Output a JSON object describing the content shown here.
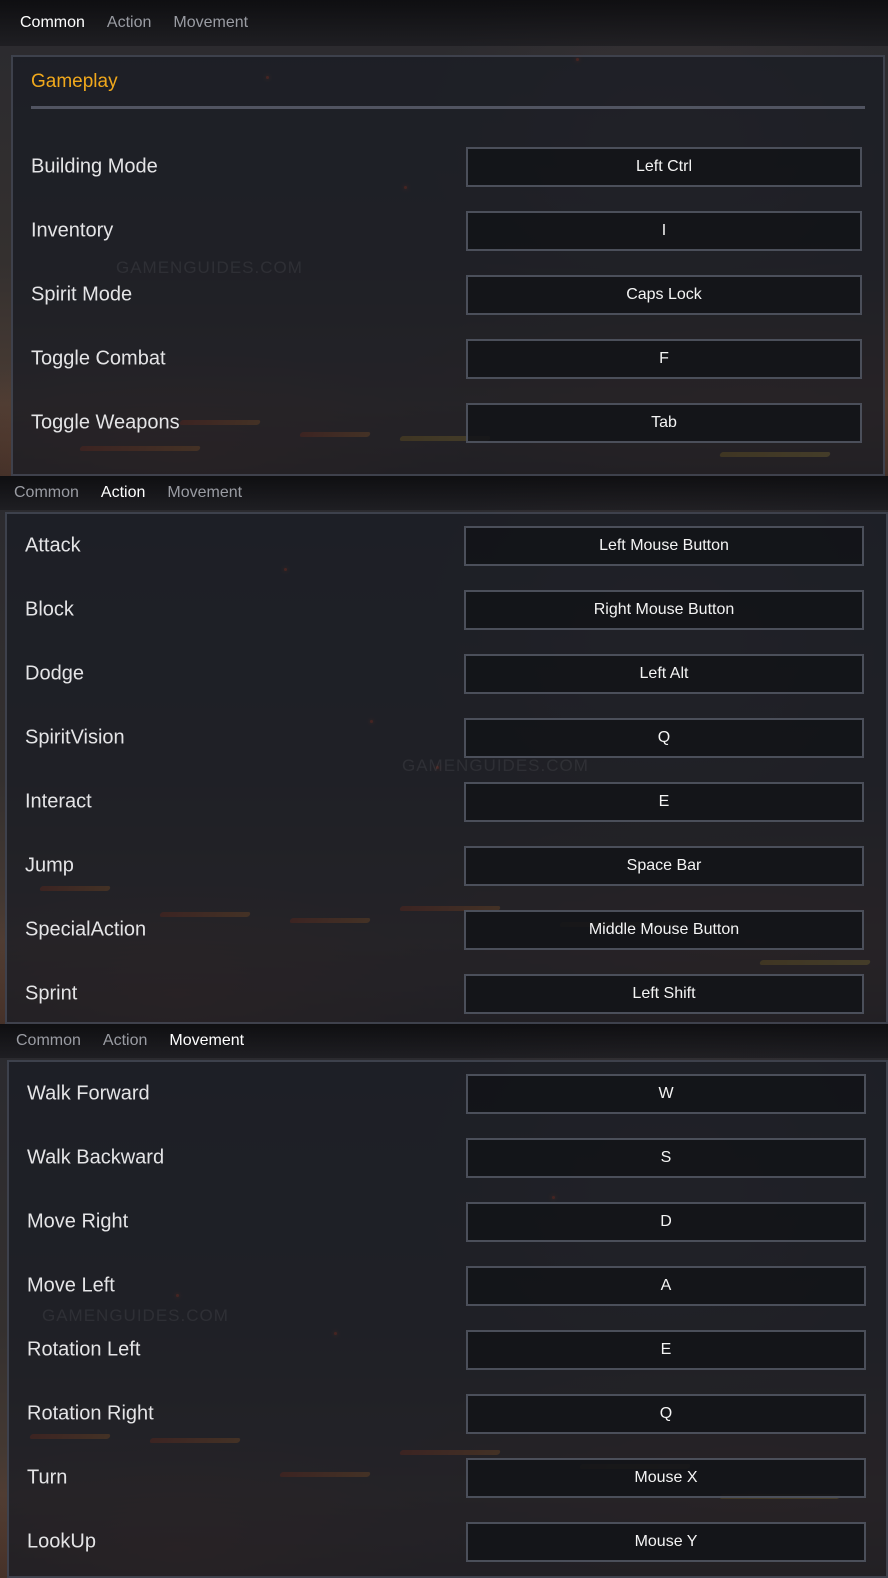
{
  "tabs": [
    "Common",
    "Action",
    "Movement"
  ],
  "watermark": "GAMENGUIDES.COM",
  "common": {
    "active_tab": "Common",
    "section_title": "Gameplay",
    "bindings": [
      {
        "action": "Building Mode",
        "key": "Left Ctrl"
      },
      {
        "action": "Inventory",
        "key": "I"
      },
      {
        "action": "Spirit Mode",
        "key": "Caps Lock"
      },
      {
        "action": "Toggle Combat",
        "key": "F"
      },
      {
        "action": "Toggle Weapons",
        "key": "Tab"
      }
    ]
  },
  "action": {
    "active_tab": "Action",
    "bindings": [
      {
        "action": "Attack",
        "key": "Left Mouse Button"
      },
      {
        "action": "Block",
        "key": "Right Mouse Button"
      },
      {
        "action": "Dodge",
        "key": "Left Alt"
      },
      {
        "action": "SpiritVision",
        "key": "Q"
      },
      {
        "action": "Interact",
        "key": "E"
      },
      {
        "action": "Jump",
        "key": "Space Bar"
      },
      {
        "action": "SpecialAction",
        "key": "Middle Mouse Button"
      },
      {
        "action": "Sprint",
        "key": "Left Shift"
      }
    ]
  },
  "movement": {
    "active_tab": "Movement",
    "bindings": [
      {
        "action": "Walk Forward",
        "key": "W"
      },
      {
        "action": "Walk Backward",
        "key": "S"
      },
      {
        "action": "Move Right",
        "key": "D"
      },
      {
        "action": "Move Left",
        "key": "A"
      },
      {
        "action": "Rotation Left",
        "key": "E"
      },
      {
        "action": "Rotation Right",
        "key": "Q"
      },
      {
        "action": "Turn",
        "key": "Mouse X"
      },
      {
        "action": "LookUp",
        "key": "Mouse Y"
      }
    ]
  },
  "colors": {
    "accent": "#f0a81c",
    "panel_bg": "#1a1c24",
    "key_border": "#4e525e",
    "lava": "#e05a20"
  }
}
